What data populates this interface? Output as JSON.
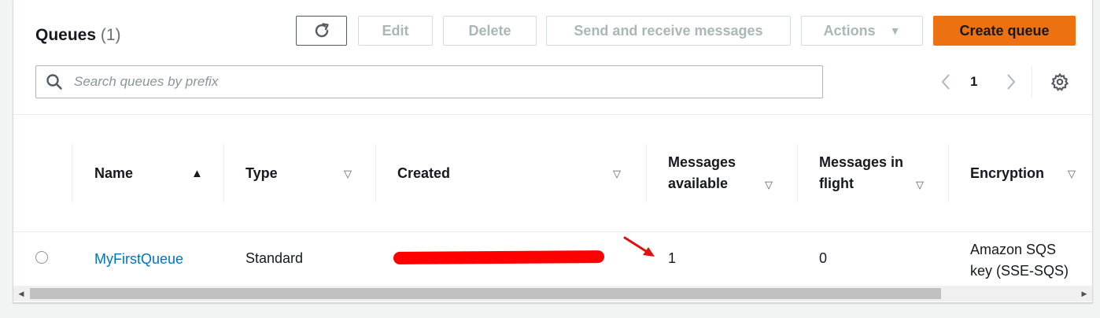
{
  "header": {
    "title": "Queues",
    "count": "(1)"
  },
  "toolbar": {
    "edit_label": "Edit",
    "delete_label": "Delete",
    "send_label": "Send and receive messages",
    "actions_label": "Actions",
    "create_label": "Create queue"
  },
  "search": {
    "placeholder": "Search queues by prefix",
    "value": ""
  },
  "pagination": {
    "current_page": "1"
  },
  "table": {
    "columns": [
      {
        "label": "Name",
        "sort": "ascending"
      },
      {
        "label": "Type",
        "sort": "none"
      },
      {
        "label": "Created",
        "sort": "none"
      },
      {
        "label": "Messages available",
        "line1": "Messages",
        "line2": "available",
        "sort": "none"
      },
      {
        "label": "Messages in flight",
        "line1": "Messages in",
        "line2": "flight",
        "sort": "none"
      },
      {
        "label": "Encryption",
        "sort": "none"
      }
    ],
    "rows": [
      {
        "selected": false,
        "name": "MyFirstQueue",
        "type": "Standard",
        "created": "",
        "messages_available": "1",
        "messages_in_flight": "0",
        "encryption_line1": "Amazon SQS",
        "encryption_line2": "key (SSE-SQS)"
      }
    ]
  },
  "colors": {
    "primary_button": "#ec7211",
    "link": "#0073bb",
    "redaction": "#ff0000",
    "annotation_arrow": "#e01010"
  },
  "icons": {
    "refresh": "refresh-icon",
    "search": "search-icon",
    "settings": "gear-icon",
    "actions_caret": "caret-down-icon"
  }
}
